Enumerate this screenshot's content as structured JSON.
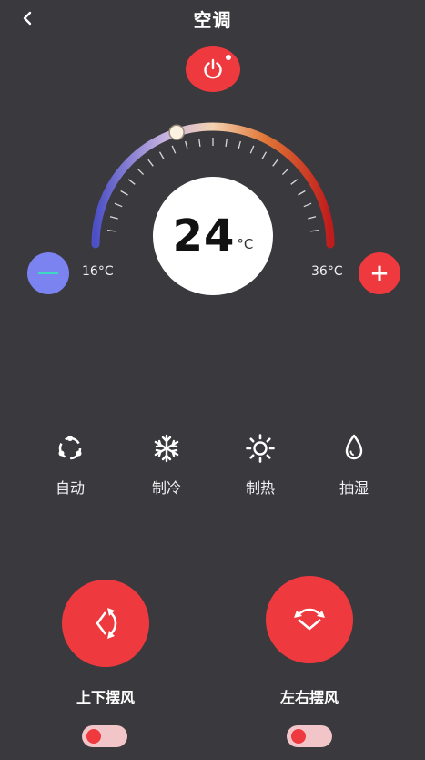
{
  "header": {
    "title": "空调"
  },
  "temperature": {
    "value": "24",
    "unit": "°C",
    "min_label": "16°C",
    "max_label": "36°C",
    "min": 16,
    "max": 36,
    "current": 24
  },
  "modes": [
    {
      "label": "自动",
      "icon": "auto-cycle-icon"
    },
    {
      "label": "制冷",
      "icon": "snowflake-icon"
    },
    {
      "label": "制热",
      "icon": "sun-icon"
    },
    {
      "label": "抽湿",
      "icon": "water-drop-icon"
    }
  ],
  "swing": [
    {
      "label": "上下摆风",
      "icon": "vertical-swing-icon",
      "on": false
    },
    {
      "label": "左右摆风",
      "icon": "horizontal-swing-icon",
      "on": false
    }
  ],
  "colors": {
    "background": "#3a393d",
    "accent_red": "#ee3a3e",
    "accent_blue": "#7b83f0",
    "arc_start": "#5054c8",
    "arc_mid": "#f0c8a0",
    "arc_end": "#c82020"
  }
}
